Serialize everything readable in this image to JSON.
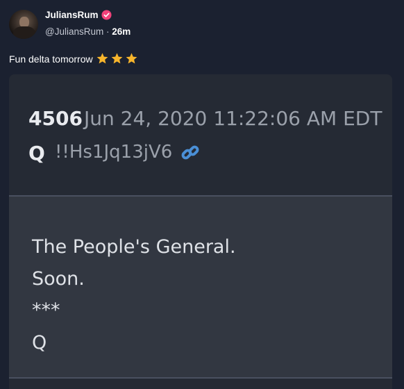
{
  "author": {
    "display_name": "JuliansRum",
    "handle": "@JuliansRum",
    "time": "26m",
    "separator": "·"
  },
  "post": {
    "text": "Fun delta tomorrow",
    "emoji": [
      "star",
      "star",
      "star"
    ]
  },
  "embed": {
    "number": "4506",
    "date": "Jun 24, 2020 11:22:06 AM EDT",
    "poster": "Q",
    "tripcode": "!!Hs1Jq13jV6",
    "lines": [
      "The People's General.",
      "Soon.",
      "***",
      "Q"
    ]
  },
  "colors": {
    "background": "#1b2130",
    "embed_header": "#252a34",
    "embed_body": "#323741",
    "link_icon": "#4a8fd6",
    "verified_badge": "#f0427a",
    "star": "#f7b52c"
  }
}
